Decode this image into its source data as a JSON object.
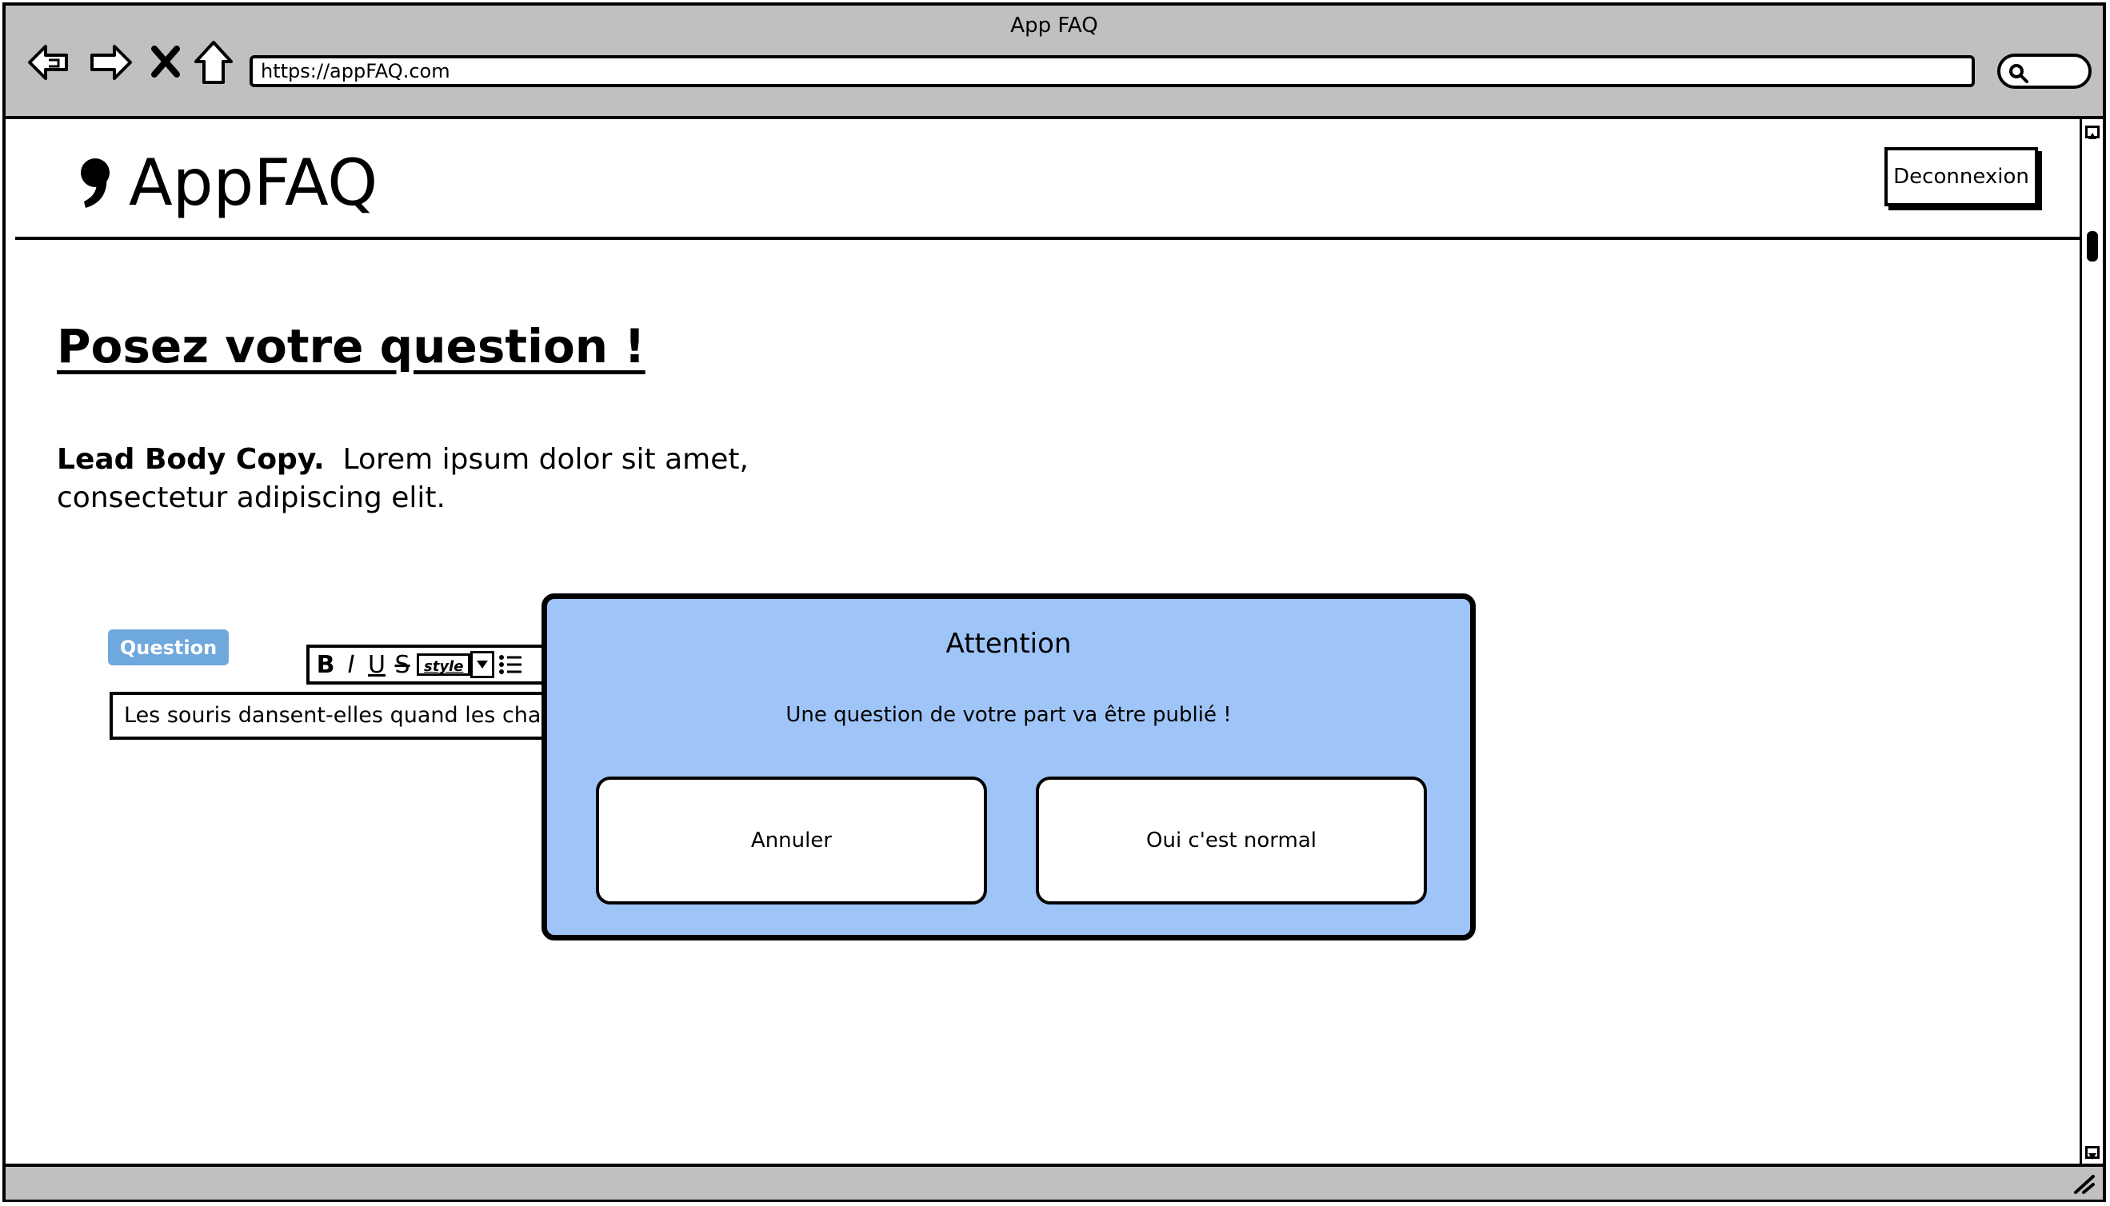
{
  "browser": {
    "window_title": "App FAQ",
    "url": "https://appFAQ.com"
  },
  "header": {
    "logo_text": "AppFAQ",
    "logout_label": "Deconnexion"
  },
  "main": {
    "page_title": "Posez votre question !",
    "lead_bold": "Lead Body Copy.",
    "lead_text": "Lorem ipsum dolor sit amet, consectetur adipiscing elit.",
    "question_badge": "Question",
    "editor_toolbar": {
      "bold": "B",
      "italic": "I",
      "underline": "U",
      "strike": "S",
      "style_label": "style"
    },
    "question_value": "Les souris dansent-elles quand les chats ne sont pas là ?"
  },
  "modal": {
    "title": "Attention",
    "message": "Une question de votre part va être publié !",
    "cancel_label": "Annuler",
    "confirm_label": "Oui c'est normal"
  },
  "colors": {
    "chrome": "#c0c0c0",
    "modal_bg": "#9fc5f8",
    "badge_bg": "#6fa8dc"
  }
}
